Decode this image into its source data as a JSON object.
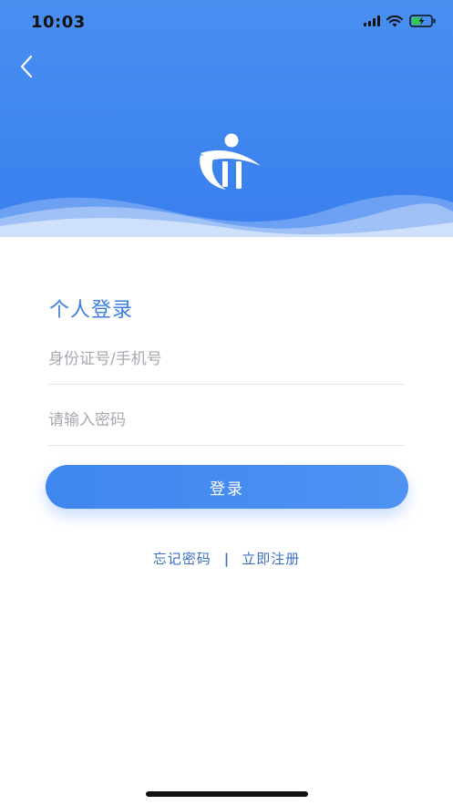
{
  "status_bar": {
    "time": "10:03"
  },
  "header": {
    "back_icon": "chevron-left-icon",
    "logo_icon": "app-logo-icon"
  },
  "login": {
    "title": "个人登录",
    "account_placeholder": "身份证号/手机号",
    "account_value": "",
    "password_placeholder": "请输入密码",
    "password_value": "",
    "submit_label": "登录"
  },
  "links": {
    "forgot_password": "忘记密码",
    "separator": "|",
    "register": "立即注册"
  },
  "colors": {
    "accent": "#3f86ef",
    "title": "#3d7fe0",
    "link": "#3b6fc2",
    "placeholder": "#a5a9b0"
  }
}
